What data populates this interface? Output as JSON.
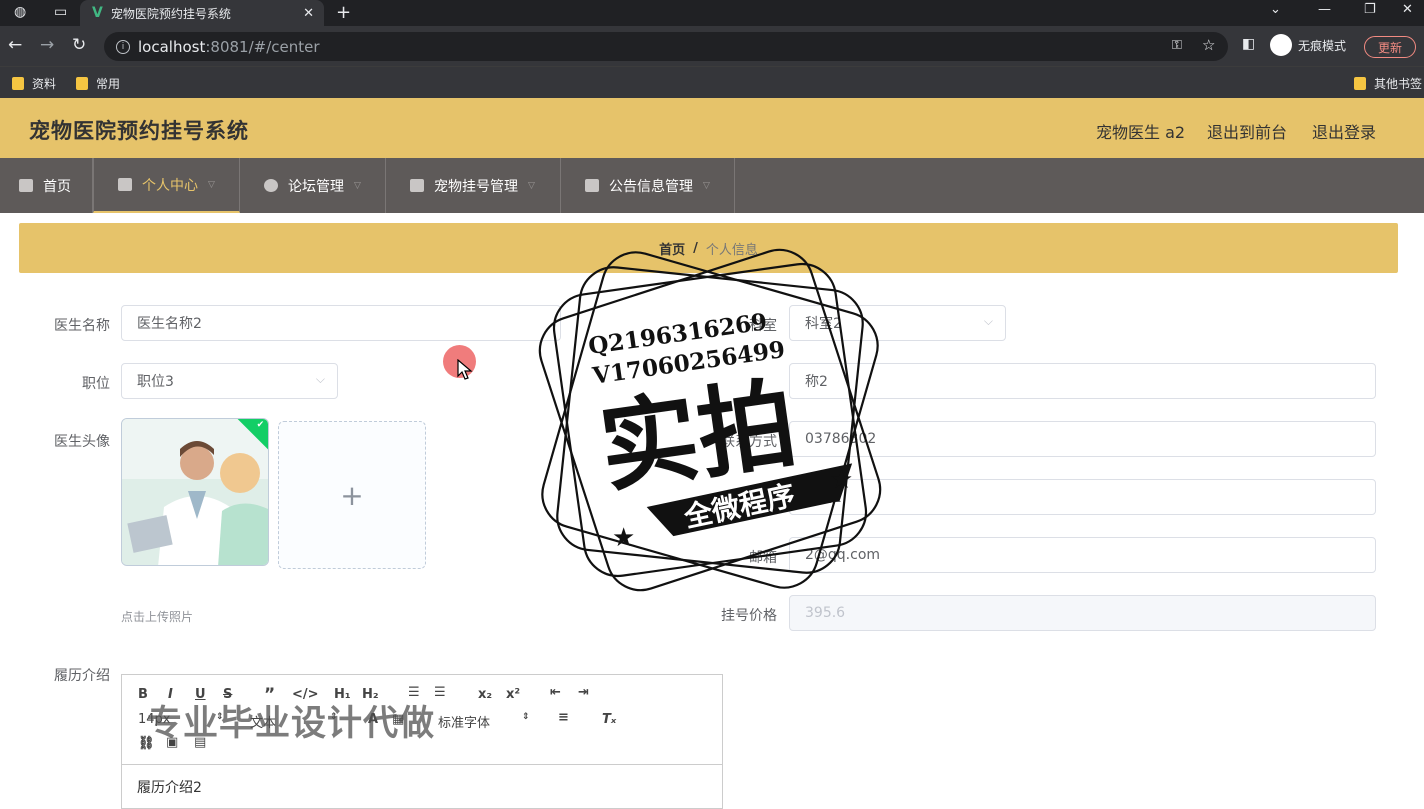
{
  "browser": {
    "tab_title": "宠物医院预约挂号系统",
    "tab_close": "✕",
    "new_tab": "+",
    "url_host": "localhost",
    "url_rest": ":8081/#/center",
    "incognito_label": "无痕模式",
    "update_label": "更新",
    "bookmarks": [
      "资料",
      "常用"
    ],
    "other_bookmarks": "其他书签"
  },
  "header": {
    "title": "宠物医院预约挂号系统",
    "user": "宠物医生 a2",
    "to_front": "退出到前台",
    "logout": "退出登录"
  },
  "menu": {
    "items": [
      {
        "label": "首页"
      },
      {
        "label": "个人中心"
      },
      {
        "label": "论坛管理"
      },
      {
        "label": "宠物挂号管理"
      },
      {
        "label": "公告信息管理"
      }
    ]
  },
  "breadcrumb": {
    "home": "首页",
    "separator": "/",
    "current": "个人信息"
  },
  "form": {
    "doctor_name_label": "医生名称",
    "doctor_name_value": "医生名称2",
    "department_label": "科室",
    "department_value": "科室2",
    "position_label": "职位",
    "position_value": "职位3",
    "title_value": "称2",
    "avatar_label": "医生头像",
    "contact_label": "联系方式",
    "contact_value": "03786302",
    "idcard_value": "号码2",
    "email_label": "邮箱",
    "email_value": "2@qq.com",
    "price_label": "挂号价格",
    "price_value": "395.6",
    "upload_tip": "点击上传照片",
    "upload_plus": "+",
    "resume_label": "履历介绍",
    "resume_value": "履历介绍2"
  },
  "editor_toolbar": {
    "font_size": "14px",
    "text_type": "文本",
    "font_family": "标准字体"
  },
  "overlay": {
    "qq": "Q2196316269",
    "wechat": "V17060256499",
    "stamp_main": "实拍",
    "stamp_sub": "全微程序",
    "watermark": "专业毕业设计代做"
  },
  "colors": {
    "header_bg": "#e6c36a",
    "nav_bg": "#5e5a59"
  }
}
